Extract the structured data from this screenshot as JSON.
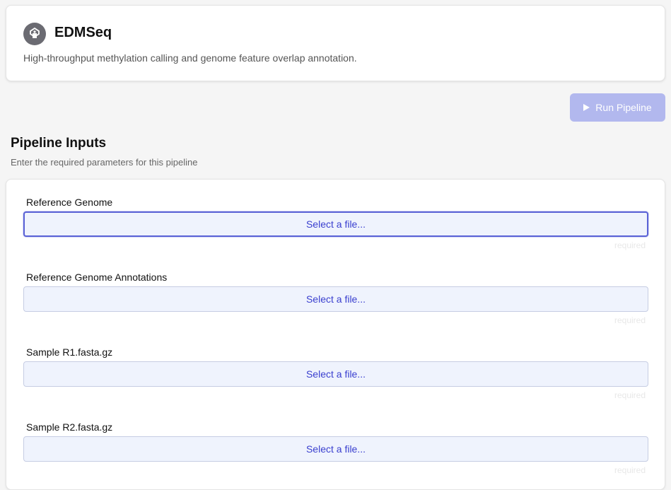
{
  "app": {
    "title": "EDMSeq",
    "description": "High-throughput methylation calling and genome feature overlap annotation.",
    "logo_icon": "pipeline-logo-icon"
  },
  "toolbar": {
    "run_label": "Run Pipeline",
    "run_icon": "play-icon",
    "run_enabled": false,
    "run_color": "#b2b8ee"
  },
  "inputs_section": {
    "title": "Pipeline Inputs",
    "description": "Enter the required parameters for this pipeline",
    "fields": [
      {
        "label": "Reference Genome",
        "button_label": "Select a file...",
        "hint": "required",
        "focused": true
      },
      {
        "label": "Reference Genome Annotations",
        "button_label": "Select a file...",
        "hint": "required",
        "focused": false
      },
      {
        "label": "Sample R1.fasta.gz",
        "button_label": "Select a file...",
        "hint": "required",
        "focused": false
      },
      {
        "label": "Sample R2.fasta.gz",
        "button_label": "Select a file...",
        "hint": "required",
        "focused": false
      }
    ]
  },
  "colors": {
    "accent": "#3a3fcf",
    "focus_ring": "#5a62d6",
    "file_button_bg": "#eff3fd"
  }
}
